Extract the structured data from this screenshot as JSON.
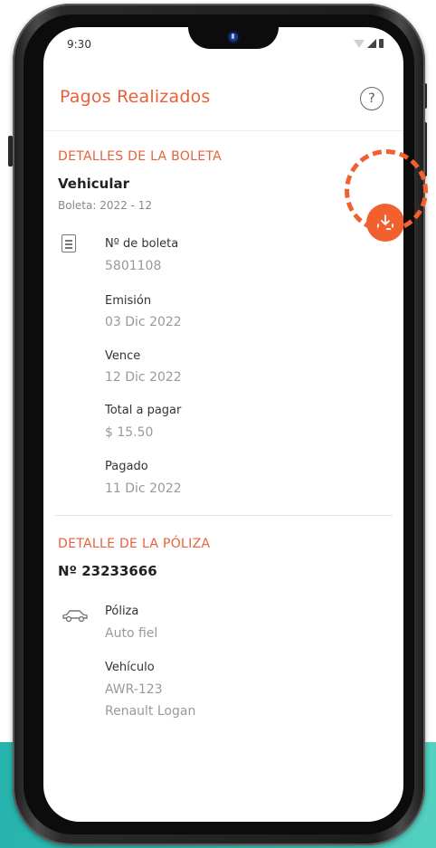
{
  "status_bar": {
    "time": "9:30",
    "icons": [
      "wifi-icon",
      "signal-icon",
      "battery-icon"
    ]
  },
  "header": {
    "title": "Pagos Realizados",
    "help_icon": "?"
  },
  "boleta": {
    "section_title": "DETALLES DE LA BOLETA",
    "type": "Vehicular",
    "period": "Boleta: 2022 - 12",
    "fields": [
      {
        "label": "Nº de boleta",
        "value": "5801108"
      },
      {
        "label": "Emisión",
        "value": "03 Dic 2022"
      },
      {
        "label": "Vence",
        "value": "12 Dic 2022"
      },
      {
        "label": "Total a pagar",
        "value": "$ 15.50"
      },
      {
        "label": "Pagado",
        "value": "11 Dic 2022"
      }
    ]
  },
  "poliza": {
    "section_title": "DETALLE DE LA PÓLIZA",
    "number": "Nº 23233666",
    "fields": [
      {
        "label": "Póliza",
        "value": "Auto fiel"
      },
      {
        "label": "Vehículo",
        "value": "AWR-123",
        "value2": "Renault Logan"
      }
    ]
  },
  "colors": {
    "accent": "#e8613a",
    "download_button": "#f2602f",
    "teal": "#3bc3b7"
  }
}
